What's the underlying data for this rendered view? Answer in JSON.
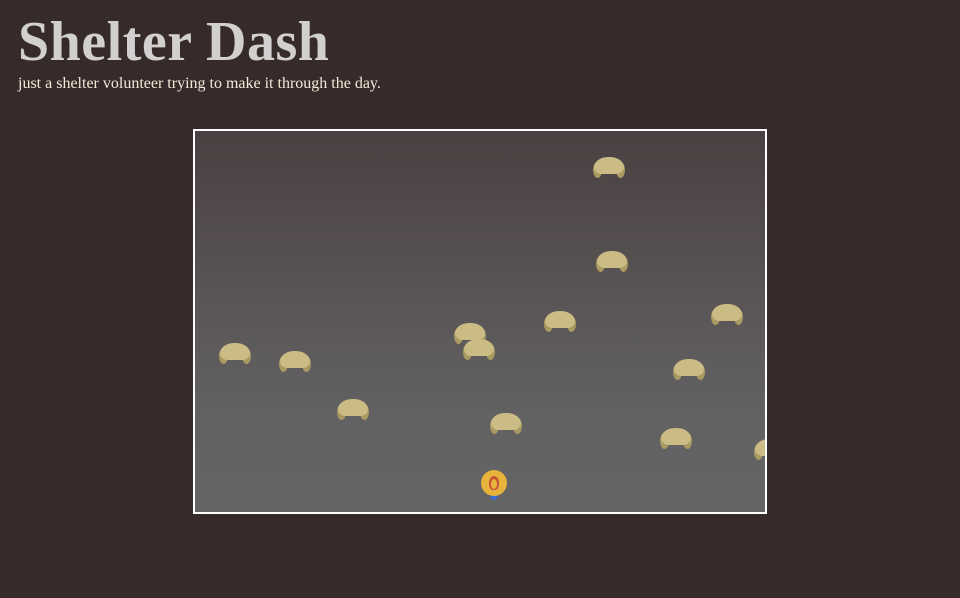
{
  "header": {
    "title": "Shelter Dash",
    "subtitle": "just a shelter volunteer trying to make it through the day."
  },
  "game": {
    "colors": {
      "page_background": "#362a2b",
      "frame_border": "#ffffff",
      "bed_fill": "#cbbc86",
      "bed_legs": "#a99a62",
      "player_body": "#e8b33a",
      "player_hair": "#c9543a",
      "player_feet": "#3a6fd0"
    },
    "sprites": {
      "bed": "dog-bed-icon",
      "player": "volunteer-icon"
    }
  }
}
